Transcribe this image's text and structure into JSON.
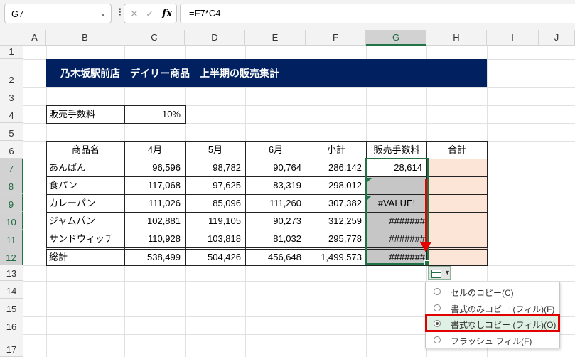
{
  "formula_bar": {
    "name_box": "G7",
    "formula": "=F7*C4",
    "more_icon": "⋮",
    "cancel_icon": "✕",
    "enter_icon": "✓",
    "fx_label": "fx"
  },
  "columns": [
    "A",
    "B",
    "C",
    "D",
    "E",
    "F",
    "G",
    "H",
    "I",
    "J"
  ],
  "rows": [
    "1",
    "2",
    "3",
    "4",
    "5",
    "6",
    "7",
    "8",
    "9",
    "10",
    "11",
    "12",
    "13",
    "14",
    "15",
    "16",
    "17"
  ],
  "sheet": {
    "title": "乃木坂駅前店　デイリー商品　上半期の販売集計",
    "commission_label": "販売手数料",
    "commission_value": "10%",
    "table": {
      "headers": [
        "商品名",
        "4月",
        "5月",
        "6月",
        "小計",
        "販売手数料",
        "合計"
      ],
      "rows": [
        [
          "あんぱん",
          "96,596",
          "98,782",
          "90,764",
          "286,142",
          "28,614",
          ""
        ],
        [
          "食パン",
          "117,068",
          "97,625",
          "83,319",
          "298,012",
          "-",
          ""
        ],
        [
          "カレーパン",
          "111,026",
          "85,096",
          "111,260",
          "307,382",
          "#VALUE!",
          ""
        ],
        [
          "ジャムパン",
          "102,881",
          "119,105",
          "90,273",
          "312,259",
          "#######",
          ""
        ],
        [
          "サンドウィッチ",
          "110,928",
          "103,818",
          "81,032",
          "295,778",
          "#######",
          ""
        ]
      ],
      "total_row": [
        "総計",
        "538,499",
        "504,426",
        "456,648",
        "1,499,573",
        "#######",
        ""
      ]
    },
    "colors": {
      "title_bg": "#002060",
      "total_col_bg": "#fce4d6",
      "selection": "#217346",
      "arrow": "#e60000"
    }
  },
  "autofill_menu": {
    "options": [
      {
        "label": "セルのコピー(C)",
        "selected": false
      },
      {
        "label": "書式のみコピー (フィル)(F)",
        "selected": false
      },
      {
        "label": "書式なしコピー (フィル)(O)",
        "selected": true
      },
      {
        "label": "フラッシュ フィル(F)",
        "selected": false
      }
    ]
  }
}
